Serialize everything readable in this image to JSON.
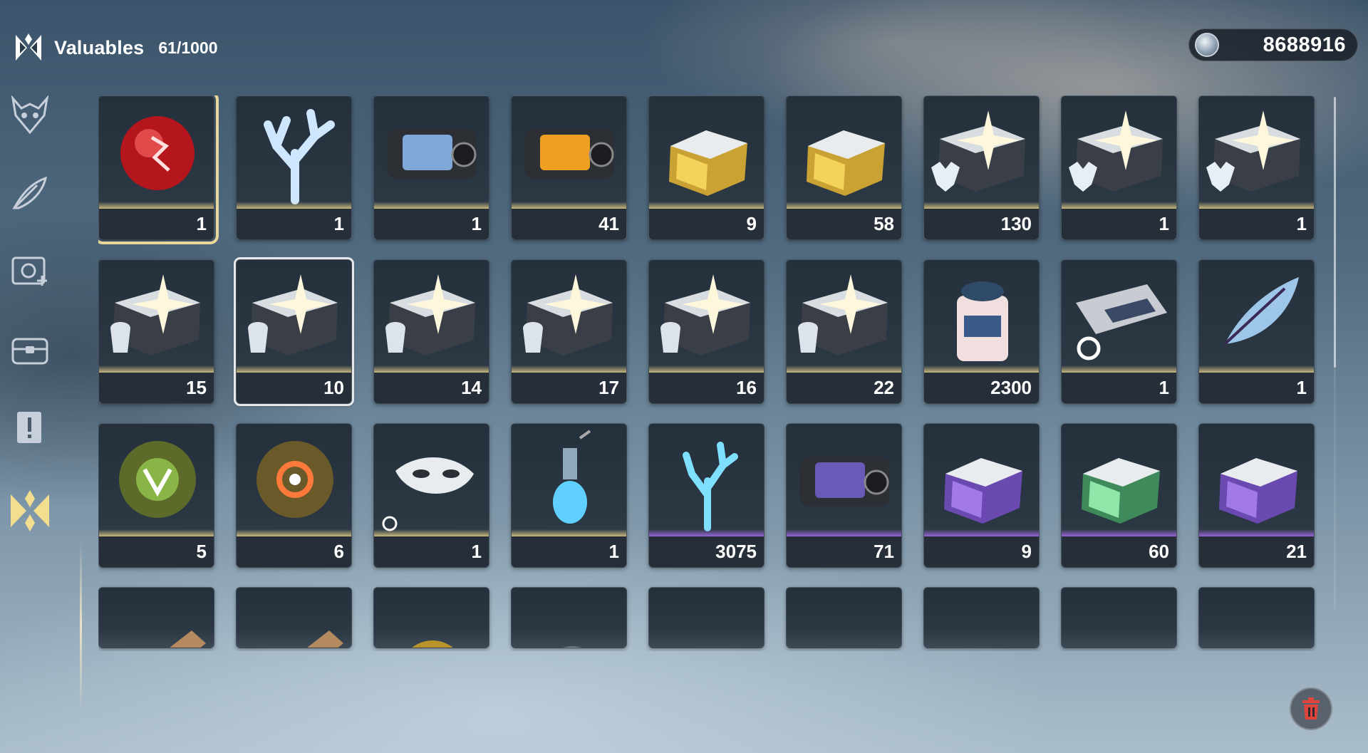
{
  "header": {
    "title": "Valuables",
    "capacity": "61/1000"
  },
  "currency": {
    "icon": "shell-credit-icon",
    "value": "8688916"
  },
  "sidebar": {
    "items": [
      {
        "icon": "demon-mask-icon"
      },
      {
        "icon": "feather-icon"
      },
      {
        "icon": "gear-camera-icon"
      },
      {
        "icon": "treasure-chest-icon"
      },
      {
        "icon": "exclamation-note-icon"
      },
      {
        "icon": "valuables-icon",
        "active": true
      }
    ]
  },
  "items": [
    {
      "icon": "red-orb-icon",
      "qty": "1",
      "rarity": "gold",
      "state": "selected"
    },
    {
      "icon": "crystal-coral-icon",
      "qty": "1",
      "rarity": "gold"
    },
    {
      "icon": "supply-case-blue-icon",
      "qty": "1",
      "rarity": "gold"
    },
    {
      "icon": "supply-case-orange-icon",
      "qty": "41",
      "rarity": "gold"
    },
    {
      "icon": "gold-supply-box-icon",
      "qty": "9",
      "rarity": "gold"
    },
    {
      "icon": "gold-supply-box-icon",
      "qty": "58",
      "rarity": "gold"
    },
    {
      "icon": "echo-chest-wolf-icon",
      "qty": "130",
      "rarity": "gold"
    },
    {
      "icon": "echo-chest-wolf-icon",
      "qty": "1",
      "rarity": "gold"
    },
    {
      "icon": "echo-chest-wolf-icon",
      "qty": "1",
      "rarity": "gold"
    },
    {
      "icon": "echo-chest-helmet-icon",
      "qty": "15",
      "rarity": "gold"
    },
    {
      "icon": "echo-chest-helmet-icon",
      "qty": "10",
      "rarity": "gold",
      "state": "hovered"
    },
    {
      "icon": "echo-chest-helmet-icon",
      "qty": "14",
      "rarity": "gold"
    },
    {
      "icon": "echo-chest-helmet-icon",
      "qty": "17",
      "rarity": "gold"
    },
    {
      "icon": "echo-chest-helmet-icon",
      "qty": "16",
      "rarity": "gold"
    },
    {
      "icon": "echo-chest-helmet-icon",
      "qty": "22",
      "rarity": "gold"
    },
    {
      "icon": "salt-jar-icon",
      "qty": "2300",
      "rarity": "gold"
    },
    {
      "icon": "ticket-recycle-icon",
      "qty": "1",
      "rarity": "gold"
    },
    {
      "icon": "crystal-feather-icon",
      "qty": "1",
      "rarity": "gold"
    },
    {
      "icon": "green-emblem-orb-icon",
      "qty": "5",
      "rarity": "gold"
    },
    {
      "icon": "orange-emblem-orb-icon",
      "qty": "6",
      "rarity": "gold"
    },
    {
      "icon": "white-mask-icon",
      "qty": "1",
      "rarity": "gold"
    },
    {
      "icon": "blue-potion-bottle-icon",
      "qty": "1",
      "rarity": "gold"
    },
    {
      "icon": "blue-coral-icon",
      "qty": "3075",
      "rarity": "purple"
    },
    {
      "icon": "supply-case-purple-icon",
      "qty": "71",
      "rarity": "purple"
    },
    {
      "icon": "purple-supply-box-icon",
      "qty": "9",
      "rarity": "purple"
    },
    {
      "icon": "green-supply-box-icon",
      "qty": "60",
      "rarity": "purple"
    },
    {
      "icon": "purple-supply-box-icon",
      "qty": "21",
      "rarity": "purple"
    },
    {
      "icon": "wooden-plank-icon",
      "partial": true
    },
    {
      "icon": "wooden-plank-icon",
      "partial": true
    },
    {
      "icon": "gold-coin-icon",
      "partial": true
    },
    {
      "icon": "helmet-relic-icon",
      "partial": true
    },
    {
      "icon": "camera-device-icon",
      "partial": true
    },
    {
      "icon": "red-flower-icon",
      "partial": true
    },
    {
      "icon": "glowing-cube-icon",
      "partial": true
    },
    {
      "icon": "dark-jar-icon",
      "partial": true
    },
    {
      "icon": "metal-case-icon",
      "partial": true
    }
  ],
  "colors": {
    "gold": "#f0d78c",
    "purple": "#b46eff",
    "selected": "#e9d79a"
  },
  "trash": {
    "icon": "trash-icon"
  }
}
